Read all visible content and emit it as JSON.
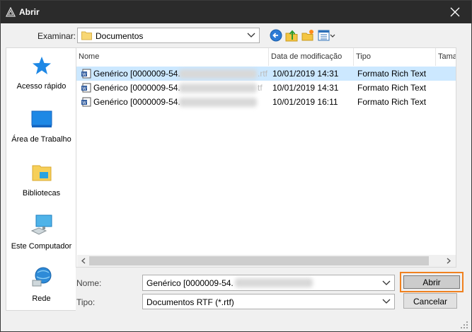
{
  "window": {
    "title": "Abrir"
  },
  "lookin": {
    "label": "Examinar:",
    "value": "Documentos"
  },
  "places": [
    {
      "label": "Acesso rápido",
      "icon": "star-icon"
    },
    {
      "label": "Área de Trabalho",
      "icon": "desktop-icon"
    },
    {
      "label": "Bibliotecas",
      "icon": "libraries-icon"
    },
    {
      "label": "Este Computador",
      "icon": "computer-icon"
    },
    {
      "label": "Rede",
      "icon": "network-icon"
    }
  ],
  "columns": [
    {
      "label": "Nome"
    },
    {
      "label": "Data de modificação"
    },
    {
      "label": "Tipo"
    },
    {
      "label": "Tama"
    }
  ],
  "files": [
    {
      "name": "Genérico [0000009-54.",
      "ext": ".rtf",
      "date": "10/01/2019 14:31",
      "type": "Formato Rich Text",
      "selected": true
    },
    {
      "name": "Genérico [0000009-54.",
      "ext": "tf",
      "date": "10/01/2019 14:31",
      "type": "Formato Rich Text",
      "selected": false
    },
    {
      "name": "Genérico [0000009-54.",
      "ext": "",
      "date": "10/01/2019 16:11",
      "type": "Formato Rich Text",
      "selected": false
    }
  ],
  "filename": {
    "label": "Nome:",
    "value": "Genérico [0000009-54."
  },
  "filetype": {
    "label": "Tipo:",
    "value": "Documentos RTF (*.rtf)"
  },
  "buttons": {
    "open": "Abrir",
    "cancel": "Cancelar"
  },
  "colors": {
    "titlebar": "#2b2b2b",
    "selection": "#cce8ff",
    "focus": "#f0811f"
  }
}
